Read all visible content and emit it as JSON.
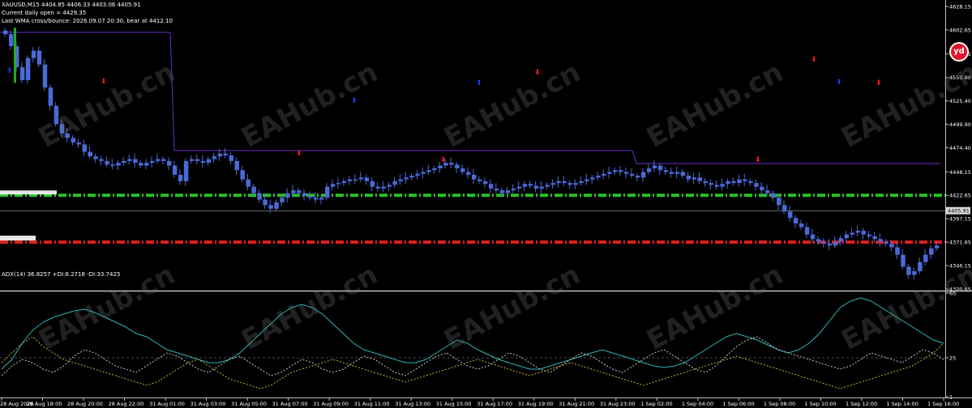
{
  "header": {
    "symbol_line": "XAUUSD,M15  4404.85 4406.33 4403.06 4405.91",
    "daily_open": "Current daily open = 4429.35",
    "wma_line": "Last WMA cross/bounce: 2026.09.07 20:30, bear at 4412.10"
  },
  "indicator_label": "ADX(14) 36.8257 +DI:8.2718 -DI:33.7425",
  "current_price": "4405.91",
  "badge_text": "yd",
  "watermark": "EAHub.cn",
  "colors": {
    "background": "#000000",
    "bull_candle": "#4a6ad8",
    "bear_candle": "#4a6ad8",
    "adx_line": "#2fb5b5",
    "plus_di": "#c8c8c8",
    "minus_di": "#c8b43a",
    "support_line": "#27c227",
    "resistance_line": "#e02020",
    "channel_line": "#6a2fc8",
    "signal_up": "#1e3aff",
    "signal_down": "#ff1a1a"
  },
  "chart_data": [
    {
      "type": "line",
      "subtype": "candlestick",
      "symbol": "XAUUSD",
      "timeframe": "M15",
      "ylim": [
        4320.65,
        4628.15
      ],
      "y_ticks": [
        "4628.15",
        "4602.65",
        "4576.45",
        "4550.90",
        "4525.40",
        "4499.90",
        "4474.40",
        "4448.15",
        "4422.65",
        "4397.15",
        "4371.65",
        "4346.15",
        "4320.65"
      ],
      "x_ticks": [
        "28 Aug 2026",
        "28 Aug 18:00",
        "28 Aug 20:00",
        "28 Aug 22:00",
        "31 Aug 01:00",
        "31 Aug 03:00",
        "31 Aug 05:00",
        "31 Aug 07:00",
        "31 Aug 09:00",
        "31 Aug 11:00",
        "31 Aug 13:00",
        "31 Aug 15:00",
        "31 Aug 17:00",
        "31 Aug 19:00",
        "31 Aug 21:00",
        "31 Aug 23:00",
        "1 Sep 02:00",
        "1 Sep 04:00",
        "1 Sep 06:00",
        "1 Sep 08:00",
        "1 Sep 10:00",
        "1 Sep 12:00",
        "1 Sep 14:00",
        "1 Sep 16:00"
      ],
      "close_series": [
        4598,
        4585,
        4562,
        4548,
        4572,
        4580,
        4565,
        4540,
        4520,
        4500,
        4490,
        4485,
        4480,
        4478,
        4470,
        4465,
        4462,
        4460,
        4456,
        4455,
        4458,
        4460,
        4462,
        4458,
        4455,
        4458,
        4460,
        4462,
        4460,
        4455,
        4445,
        4438,
        4460,
        4462,
        4460,
        4458,
        4462,
        4465,
        4468,
        4466,
        4460,
        4450,
        4440,
        4432,
        4425,
        4418,
        4412,
        4408,
        4415,
        4420,
        4425,
        4428,
        4425,
        4422,
        4420,
        4418,
        4420,
        4432,
        4435,
        4436,
        4438,
        4440,
        4440,
        4442,
        4438,
        4432,
        4430,
        4432,
        4434,
        4438,
        4440,
        4442,
        4444,
        4446,
        4448,
        4450,
        4452,
        4455,
        4458,
        4456,
        4452,
        4448,
        4445,
        4440,
        4438,
        4435,
        4430,
        4428,
        4425,
        4428,
        4430,
        4432,
        4435,
        4433,
        4430,
        4432,
        4434,
        4436,
        4438,
        4436,
        4434,
        4436,
        4438,
        4440,
        4442,
        4444,
        4446,
        4448,
        4450,
        4448,
        4446,
        4444,
        4442,
        4448,
        4452,
        4455,
        4450,
        4448,
        4446,
        4448,
        4444,
        4440,
        4442,
        4438,
        4436,
        4434,
        4432,
        4435,
        4438,
        4436,
        4440,
        4438,
        4436,
        4432,
        4428,
        4425,
        4420,
        4412,
        4405,
        4398,
        4392,
        4388,
        4380,
        4375,
        4372,
        4370,
        4368,
        4372,
        4376,
        4380,
        4382,
        4384,
        4380,
        4378,
        4375,
        4372,
        4370,
        4366,
        4358,
        4345,
        4336,
        4340,
        4350,
        4358,
        4365,
        4368
      ],
      "levels": [
        {
          "name": "support",
          "value": 4422.65
        },
        {
          "name": "resistance",
          "value": 4371.65
        },
        {
          "name": "current",
          "value": 4405.91
        }
      ]
    },
    {
      "type": "line",
      "title": "ADX(14) 36.8257 +DI:8.2718 -DI:33.7425",
      "ylim": [
        1,
        65
      ],
      "y_ticks": [
        "65",
        "25",
        "1"
      ],
      "series": [
        {
          "name": "ADX",
          "values": [
            18,
            24,
            34,
            42,
            47,
            50,
            52,
            54,
            55,
            53,
            50,
            47,
            44,
            40,
            38,
            34,
            30,
            28,
            26,
            24,
            22,
            22,
            24,
            28,
            34,
            40,
            46,
            52,
            56,
            58,
            56,
            52,
            46,
            40,
            34,
            30,
            28,
            26,
            24,
            22,
            22,
            24,
            28,
            32,
            36,
            34,
            30,
            27,
            24,
            22,
            20,
            18,
            18,
            20,
            22,
            24,
            26,
            28,
            30,
            28,
            26,
            24,
            22,
            20,
            19,
            20,
            22,
            26,
            30,
            34,
            38,
            40,
            38,
            36,
            33,
            30,
            28,
            30,
            34,
            40,
            48,
            56,
            60,
            62,
            60,
            56,
            52,
            48,
            44,
            40,
            36,
            34
          ]
        },
        {
          "name": "+DI",
          "values": [
            14,
            20,
            24,
            22,
            18,
            16,
            20,
            26,
            30,
            28,
            24,
            20,
            18,
            16,
            20,
            24,
            28,
            26,
            22,
            18,
            16,
            20,
            24,
            26,
            22,
            18,
            14,
            16,
            20,
            24,
            22,
            18,
            16,
            18,
            22,
            26,
            24,
            20,
            16,
            14,
            18,
            22,
            26,
            28,
            24,
            20,
            18,
            20,
            24,
            28,
            26,
            22,
            18,
            16,
            20,
            24,
            28,
            26,
            22,
            18,
            16,
            20,
            24,
            28,
            30,
            26,
            22,
            18,
            16,
            20,
            26,
            32,
            36,
            38,
            34,
            30,
            28,
            26,
            24,
            22,
            20,
            18,
            20,
            24,
            28,
            26,
            24,
            22,
            26,
            30,
            28,
            24
          ]
        },
        {
          "name": "-DI",
          "values": [
            22,
            28,
            34,
            38,
            32,
            28,
            24,
            22,
            20,
            18,
            16,
            14,
            12,
            10,
            8,
            10,
            14,
            18,
            22,
            24,
            20,
            16,
            12,
            10,
            8,
            6,
            8,
            12,
            16,
            18,
            20,
            22,
            24,
            22,
            20,
            18,
            16,
            14,
            12,
            10,
            12,
            14,
            16,
            18,
            20,
            22,
            24,
            22,
            20,
            18,
            16,
            14,
            16,
            18,
            20,
            22,
            20,
            18,
            16,
            14,
            12,
            10,
            8,
            10,
            12,
            14,
            16,
            18,
            20,
            22,
            24,
            26,
            24,
            22,
            20,
            18,
            16,
            14,
            12,
            10,
            8,
            6,
            8,
            10,
            12,
            14,
            16,
            18,
            20,
            24,
            28,
            34
          ]
        }
      ]
    }
  ]
}
